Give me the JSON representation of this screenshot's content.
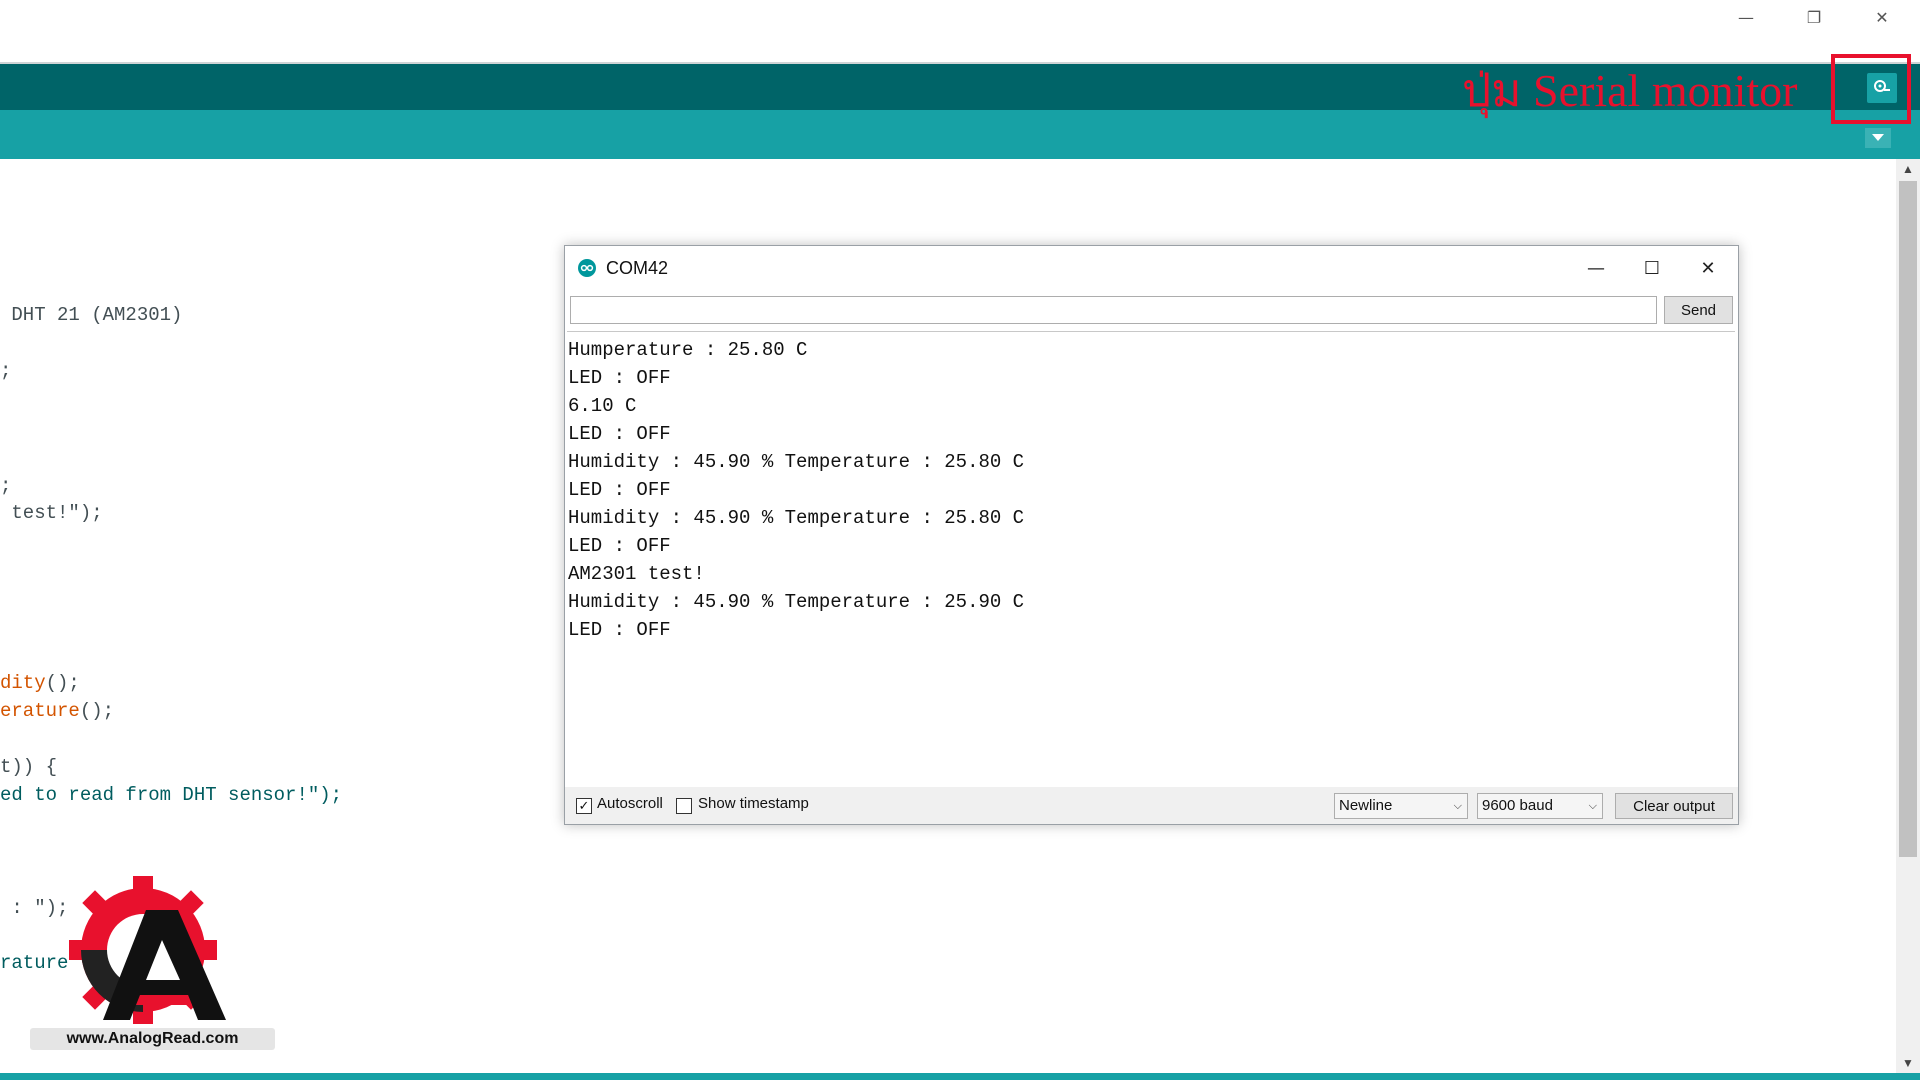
{
  "window": {
    "minimize_glyph": "—",
    "restore_glyph": "❐",
    "close_glyph": "✕"
  },
  "annotation": {
    "label": "ปุ่ม Serial monitor",
    "color": "#e8112d"
  },
  "toolbar": {
    "serial_monitor_icon": "magnifier-icon",
    "tab_menu_icon": "chevron-down-icon"
  },
  "editor": {
    "lines": [
      {
        "text": " DHT 21 (AM2301)"
      },
      {
        "text": ";"
      },
      {
        "text": ";"
      },
      {
        "text": " test!\");"
      },
      {
        "fn": "dity",
        "rest": "();"
      },
      {
        "fn": "erature",
        "rest": "();"
      },
      {
        "text": "t)) {"
      },
      {
        "text": "ed to read from DHT sensor!\");"
      },
      {
        "text": " : \");"
      },
      {
        "text": "rature"
      }
    ]
  },
  "logo": {
    "url": "www.AnalogRead.com",
    "letter": "A"
  },
  "serial_monitor": {
    "title": "COM42",
    "input_value": "",
    "send_label": "Send",
    "output_lines": [
      "Humperature : 25.80 C",
      "LED : OFF",
      "6.10 C",
      "LED : OFF",
      "Humidity : 45.90 % Temperature : 25.80 C",
      "LED : OFF",
      "Humidity : 45.90 % Temperature : 25.80 C",
      "LED : OFF",
      "AM2301 test!",
      "Humidity : 45.90 % Temperature : 25.90 C",
      "LED : OFF"
    ],
    "autoscroll_label": "Autoscroll",
    "autoscroll_checked": true,
    "timestamp_label": "Show timestamp",
    "timestamp_checked": false,
    "line_ending": "Newline",
    "baud": "9600 baud",
    "clear_label": "Clear output",
    "min_glyph": "—",
    "max_glyph": "☐",
    "close_glyph": "✕"
  }
}
